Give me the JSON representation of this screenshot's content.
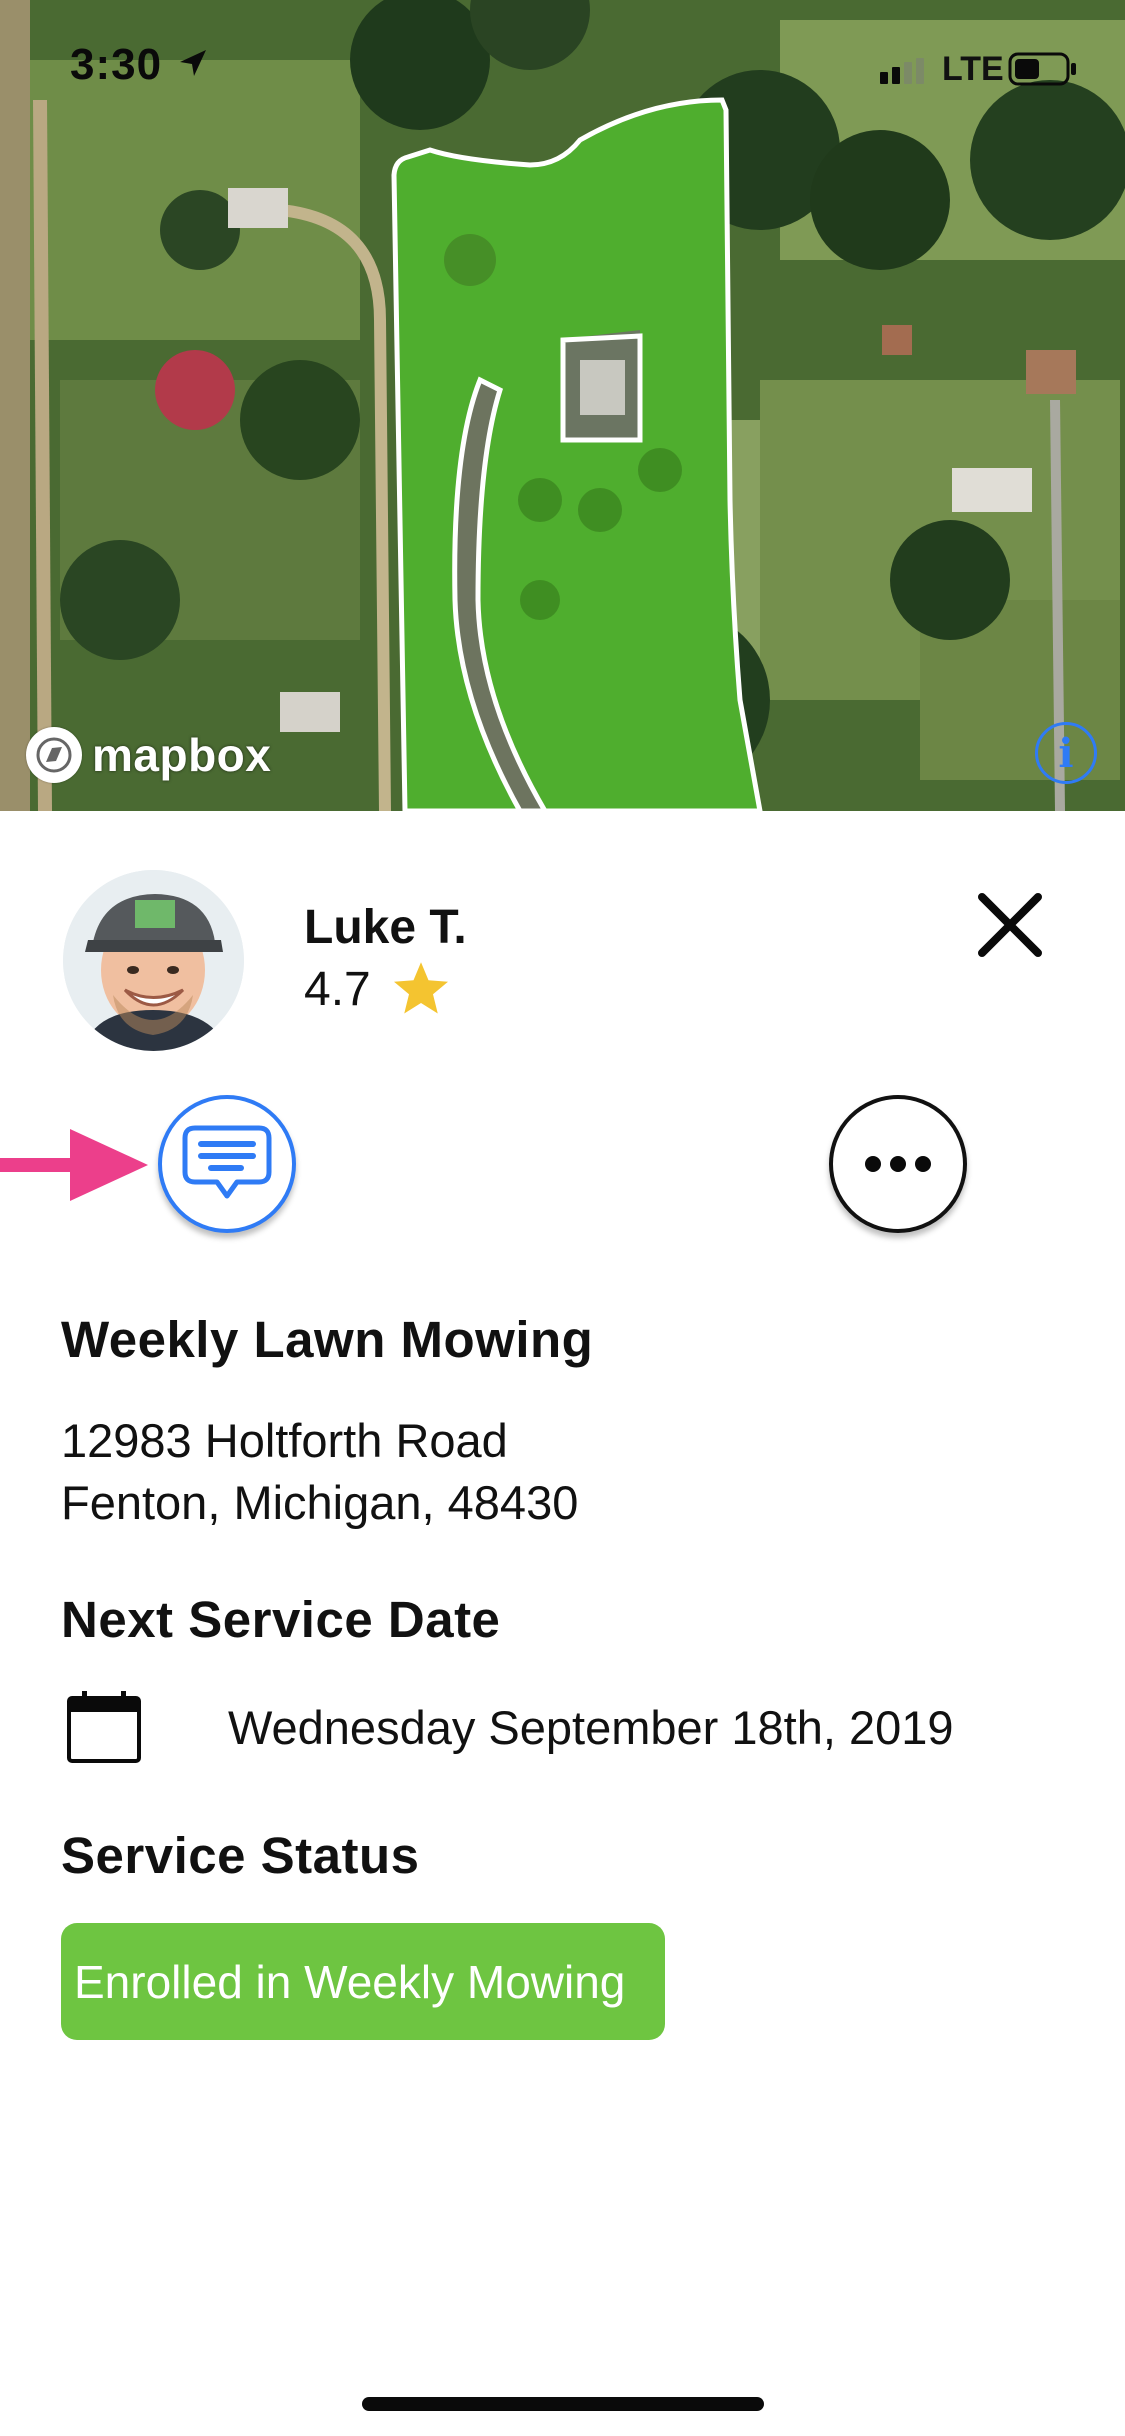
{
  "status_bar": {
    "time": "3:30",
    "network": "LTE"
  },
  "map": {
    "attribution": "mapbox",
    "info_glyph": "i",
    "lawn_color": "#4fae2e",
    "icons": [
      "location-arrow-icon",
      "signal-icon",
      "battery-icon",
      "mapbox-logo-icon",
      "info-icon"
    ]
  },
  "provider": {
    "name": "Luke T.",
    "rating": "4.7",
    "star_color": "#f4c430"
  },
  "actions": {
    "chat_icon": "chat-bubble-icon",
    "more_icon": "ellipsis-icon",
    "close_icon": "close-icon",
    "accent": "#2f7bf5",
    "arrow_color": "#ec3f8b"
  },
  "service": {
    "title": "Weekly Lawn Mowing",
    "address_line1": "12983 Holtforth Road",
    "address_line2": "Fenton, Michigan, 48430"
  },
  "next_service": {
    "heading": "Next Service Date",
    "date": "Wednesday September 18th, 2019",
    "icon": "calendar-icon"
  },
  "service_status": {
    "heading": "Service Status",
    "status": "Enrolled in Weekly Mowing",
    "color": "#6ec541"
  }
}
